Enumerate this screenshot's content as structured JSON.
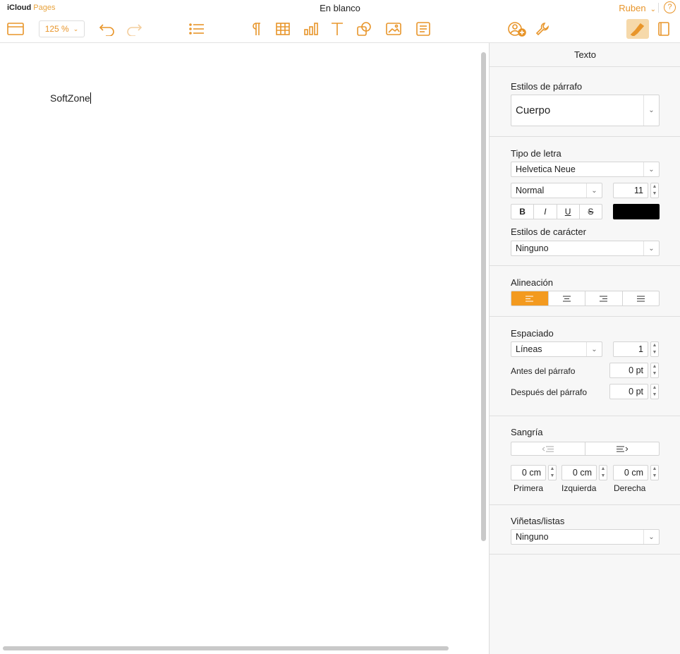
{
  "header": {
    "brand_icloud": "iCloud",
    "brand_pages": "Pages",
    "title": "En blanco",
    "user": "Ruben",
    "help": "?"
  },
  "toolbar": {
    "zoom": "125 %"
  },
  "document": {
    "text": "SoftZone"
  },
  "sidebar": {
    "tab": "Texto",
    "paragraph_styles": {
      "label": "Estilos de párrafo",
      "value": "Cuerpo"
    },
    "font": {
      "label": "Tipo de letra",
      "family": "Helvetica Neue",
      "style": "Normal",
      "size": "11",
      "format_buttons": [
        "B",
        "I",
        "U",
        "S"
      ],
      "color": "#000000"
    },
    "char_styles": {
      "label": "Estilos de carácter",
      "value": "Ninguno"
    },
    "alignment": {
      "label": "Alineación",
      "selected": "left"
    },
    "spacing": {
      "label": "Espaciado",
      "mode": "Líneas",
      "value": "1",
      "before_label": "Antes del párrafo",
      "before_value": "0 pt",
      "after_label": "Después del párrafo",
      "after_value": "0 pt"
    },
    "indent": {
      "label": "Sangría",
      "first_value": "0 cm",
      "left_value": "0 cm",
      "right_value": "0 cm",
      "first_label": "Primera",
      "left_label": "Izquierda",
      "right_label": "Derecha"
    },
    "bullets": {
      "label": "Viñetas/listas",
      "value": "Ninguno"
    }
  }
}
